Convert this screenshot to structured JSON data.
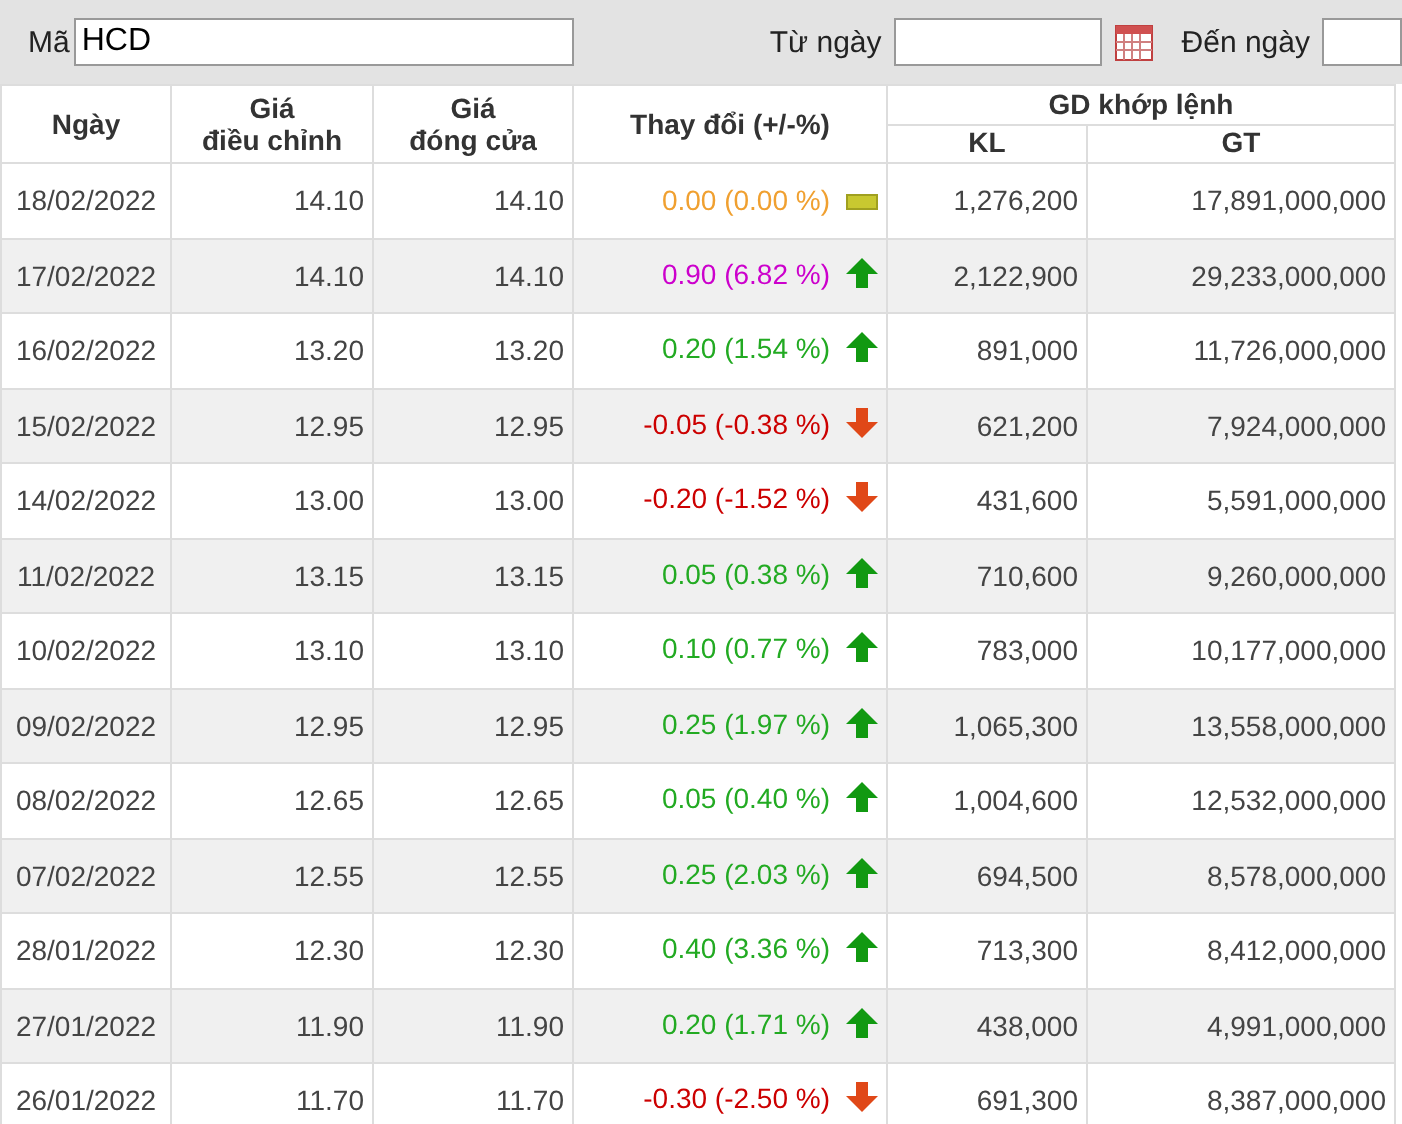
{
  "filter": {
    "code_label": "Mã",
    "code_value": "HCD",
    "from_label": "Từ ngày",
    "to_label": "Đến ngày"
  },
  "table": {
    "columns": [
      "Ngày",
      "Giá\nđiều chỉnh",
      "Giá\nđóng cửa",
      "Thay đổi (+/-%)"
    ],
    "group": "GD khớp lệnh",
    "sub_columns": [
      "KL",
      "GT"
    ],
    "rows": [
      {
        "date": "18/02/2022",
        "adjusted": "14.10",
        "close": "14.10",
        "change": "0.00 (0.00 %)",
        "kind": "flat",
        "volume": "1,276,200",
        "value": "17,891,000,000"
      },
      {
        "date": "17/02/2022",
        "adjusted": "14.10",
        "close": "14.10",
        "change": "0.90 (6.82 %)",
        "kind": "ceiling",
        "volume": "2,122,900",
        "value": "29,233,000,000"
      },
      {
        "date": "16/02/2022",
        "adjusted": "13.20",
        "close": "13.20",
        "change": "0.20 (1.54 %)",
        "kind": "up",
        "volume": "891,000",
        "value": "11,726,000,000"
      },
      {
        "date": "15/02/2022",
        "adjusted": "12.95",
        "close": "12.95",
        "change": "-0.05 (-0.38 %)",
        "kind": "down",
        "volume": "621,200",
        "value": "7,924,000,000"
      },
      {
        "date": "14/02/2022",
        "adjusted": "13.00",
        "close": "13.00",
        "change": "-0.20 (-1.52 %)",
        "kind": "down",
        "volume": "431,600",
        "value": "5,591,000,000"
      },
      {
        "date": "11/02/2022",
        "adjusted": "13.15",
        "close": "13.15",
        "change": "0.05 (0.38 %)",
        "kind": "up",
        "volume": "710,600",
        "value": "9,260,000,000"
      },
      {
        "date": "10/02/2022",
        "adjusted": "13.10",
        "close": "13.10",
        "change": "0.10 (0.77 %)",
        "kind": "up",
        "volume": "783,000",
        "value": "10,177,000,000"
      },
      {
        "date": "09/02/2022",
        "adjusted": "12.95",
        "close": "12.95",
        "change": "0.25 (1.97 %)",
        "kind": "up",
        "volume": "1,065,300",
        "value": "13,558,000,000"
      },
      {
        "date": "08/02/2022",
        "adjusted": "12.65",
        "close": "12.65",
        "change": "0.05 (0.40 %)",
        "kind": "up",
        "volume": "1,004,600",
        "value": "12,532,000,000"
      },
      {
        "date": "07/02/2022",
        "adjusted": "12.55",
        "close": "12.55",
        "change": "0.25 (2.03 %)",
        "kind": "up",
        "volume": "694,500",
        "value": "8,578,000,000"
      },
      {
        "date": "28/01/2022",
        "adjusted": "12.30",
        "close": "12.30",
        "change": "0.40 (3.36 %)",
        "kind": "up",
        "volume": "713,300",
        "value": "8,412,000,000"
      },
      {
        "date": "27/01/2022",
        "adjusted": "11.90",
        "close": "11.90",
        "change": "0.20 (1.71 %)",
        "kind": "up",
        "volume": "438,000",
        "value": "4,991,000,000"
      },
      {
        "date": "26/01/2022",
        "adjusted": "11.70",
        "close": "11.70",
        "change": "-0.30 (-2.50 %)",
        "kind": "down",
        "volume": "691,300",
        "value": "8,387,000,000"
      }
    ]
  }
}
